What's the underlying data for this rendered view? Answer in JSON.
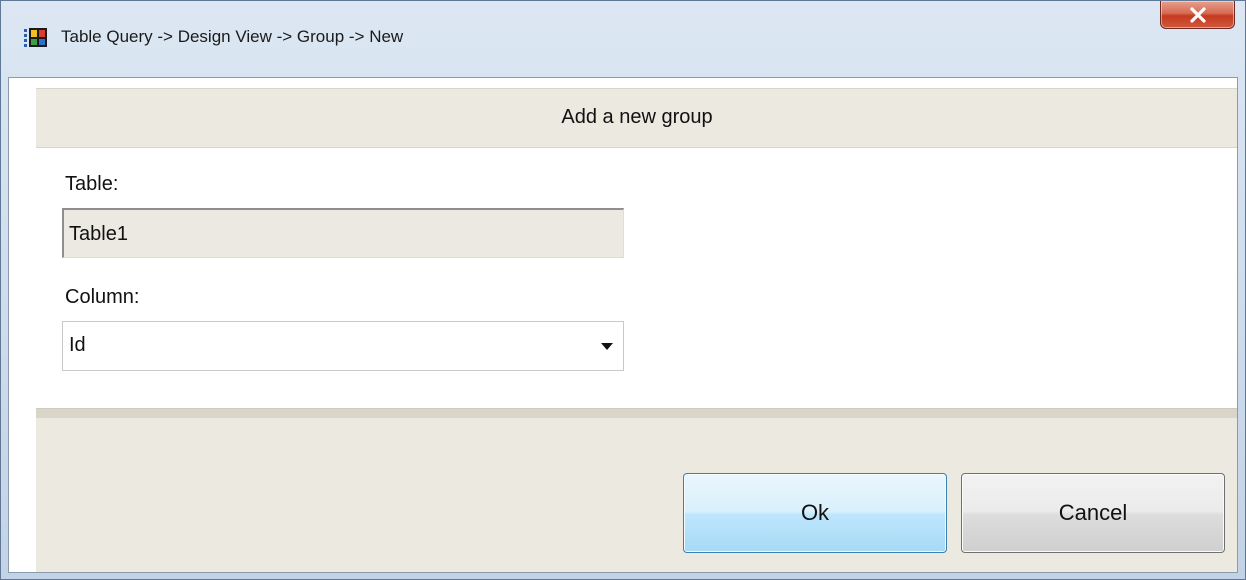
{
  "window": {
    "title": "Table Query -> Design View -> Group -> New",
    "close_label": "x"
  },
  "header": {
    "text": "Add a new group"
  },
  "table_section": {
    "label": "Table:",
    "value": "Table1"
  },
  "column_section": {
    "label": "Column:",
    "selected": "Id"
  },
  "buttons": {
    "ok": "Ok",
    "cancel": "Cancel"
  },
  "icons": {
    "app": "table-query-icon",
    "close": "close-icon",
    "dropdown": "chevron-down-icon"
  }
}
